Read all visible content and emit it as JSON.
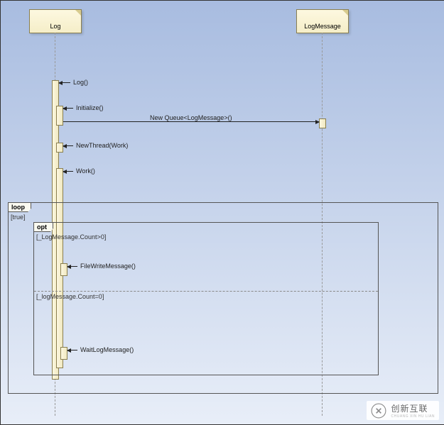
{
  "lifelines": {
    "log": {
      "label": "Log"
    },
    "logmsg": {
      "label": "LogMessage"
    }
  },
  "messages": {
    "m1": "Log()",
    "m2": "Initialize()",
    "m3": "NewThread(Work)",
    "m4": "Work()",
    "m5": "FileWriteMessage()",
    "m6": "WaitLogMessage()",
    "mq": "New Queue<LogMessage>()"
  },
  "frames": {
    "loop": {
      "tag": "loop",
      "guard": "[true]"
    },
    "opt": {
      "tag": "opt",
      "guard1": "[_LogMessage.Count>0]",
      "guard2": "[_logMessage.Count=0]"
    }
  },
  "watermark": {
    "cn": "创新互联",
    "en": "CHUANG XIN HU LIAN"
  }
}
